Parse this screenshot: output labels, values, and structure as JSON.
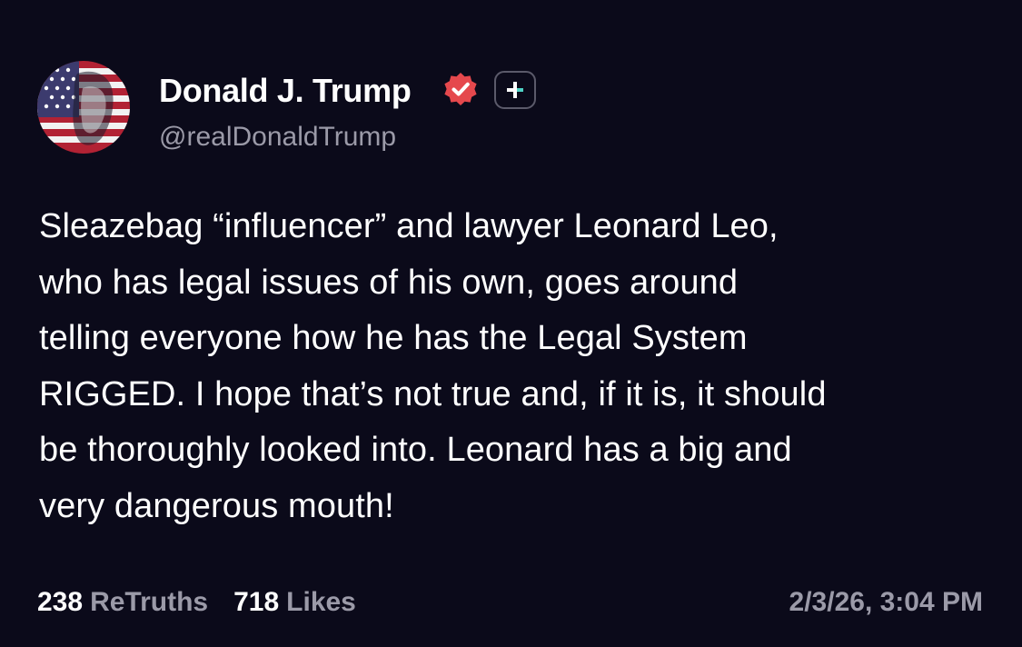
{
  "author": {
    "display_name": "Donald J. Trump",
    "handle": "@realDonaldTrump",
    "verified_icon": "verified-badge-icon",
    "follow_icon": "plus-icon"
  },
  "post": {
    "text_lines": [
      "Sleazebag “influencer” and lawyer Leonard Leo,",
      "who has legal issues of his own, goes around",
      "telling everyone how he has the Legal System",
      "RIGGED. I hope that’s not true and, if it is, it should",
      "be thoroughly looked into. Leonard has a big and",
      "very dangerous mouth!"
    ]
  },
  "stats": {
    "retruths_count": "238",
    "retruths_label": "ReTruths",
    "likes_count": "718",
    "likes_label": "Likes"
  },
  "timestamp": "2/3/26, 3:04 PM",
  "colors": {
    "background": "#0b0a1a",
    "text": "#ffffff",
    "muted": "#9b9aa8",
    "verified_badge": "#e5484d",
    "follow_plus_accent": "#4fd1c5"
  }
}
